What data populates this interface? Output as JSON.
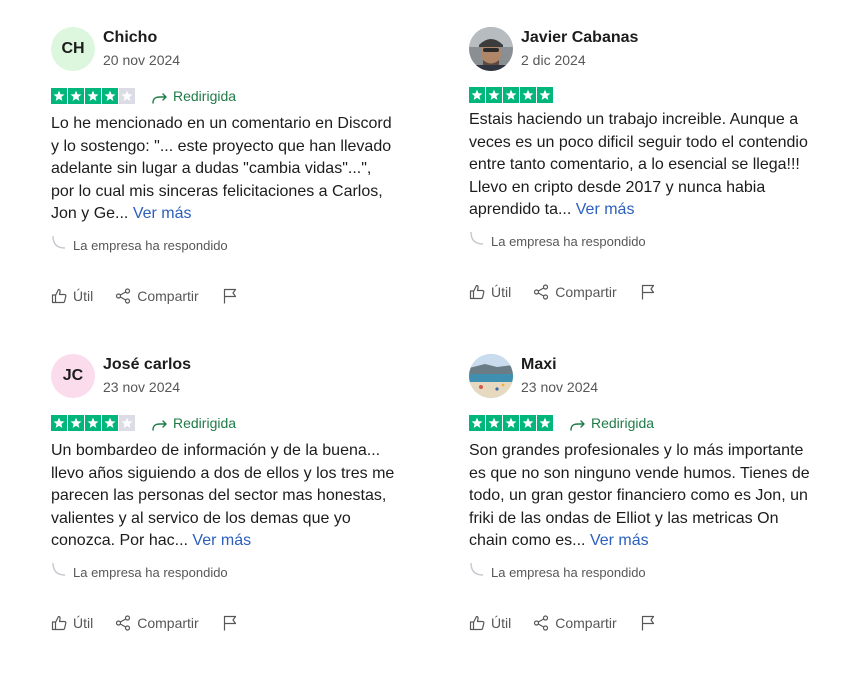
{
  "labels": {
    "read_more": "Ver más",
    "company_replied": "La empresa ha respondido",
    "useful": "Útil",
    "share": "Compartir",
    "redirected": "Redirigida"
  },
  "colors": {
    "star_green": "#00b67a",
    "star_empty": "#dcdce6",
    "redirect_green": "#1e7b47",
    "link_blue": "#2b5fbd"
  },
  "reviews": [
    {
      "author": "Chicho",
      "initials": "CH",
      "date": "20 nov 2024",
      "rating": 4,
      "redirected": true,
      "text": "Lo he mencionado en un comentario en Discord y lo sostengo: \"... este proyecto que han llevado adelante sin lugar a dudas \"cambia vidas\"...\", por lo cual mis sinceras felicitaciones a Carlos, Jon y Ge..."
    },
    {
      "author": "Javier Cabanas",
      "initials": "",
      "avatar": "photo-man-cap",
      "date": "2 dic 2024",
      "rating": 5,
      "redirected": false,
      "text": "Estais haciendo un trabajo increible. Aunque a veces es un poco dificil seguir todo el contendio entre tanto comentario, a lo esencial se llega!!! Llevo en cripto desde 2017 y nunca habia aprendido ta..."
    },
    {
      "author": "José carlos",
      "initials": "JC",
      "date": "23 nov 2024",
      "rating": 4,
      "redirected": true,
      "text": "Un bombardeo de información y de la buena... llevo años siguiendo a dos de ellos y los tres me parecen las personas del sector mas honestas, valientes y al servico de los demas que yo conozca. Por hac..."
    },
    {
      "author": "Maxi",
      "initials": "",
      "avatar": "photo-beach",
      "date": "23 nov 2024",
      "rating": 5,
      "redirected": true,
      "text": "Son grandes profesionales y lo más importante es que no son ninguno vende humos. Tienes de todo, un gran gestor financiero como es Jon, un friki de las ondas de Elliot y las metricas On chain como es..."
    }
  ]
}
